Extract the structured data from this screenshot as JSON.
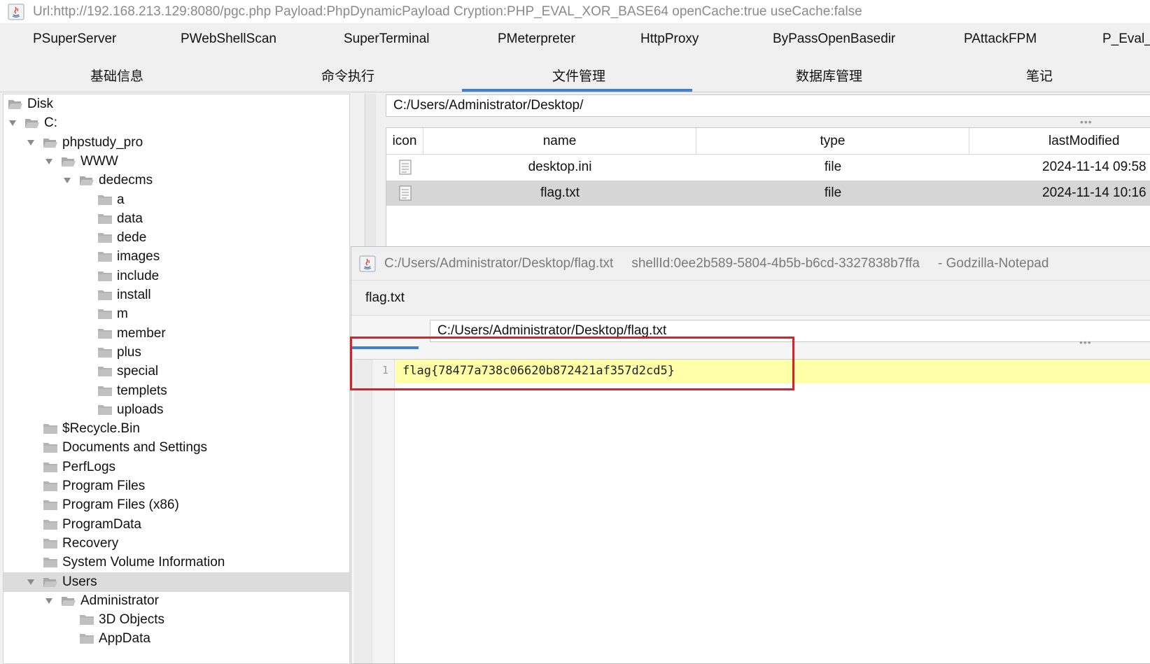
{
  "window": {
    "title": "Url:http://192.168.213.129:8080/pgc.php Payload:PhpDynamicPayload Cryption:PHP_EVAL_XOR_BASE64 openCache:true useCache:false"
  },
  "plugins": [
    "PSuperServer",
    "PWebShellScan",
    "SuperTerminal",
    "PMeterpreter",
    "HttpProxy",
    "ByPassOpenBasedir",
    "PAttackFPM",
    "P_Eval_C"
  ],
  "main_tabs": [
    "基础信息",
    "命令执行",
    "文件管理",
    "数据库管理",
    "笔记"
  ],
  "active_tab": "文件管理",
  "tree": {
    "items": [
      {
        "label": "Disk",
        "level": 0,
        "expanded": true
      },
      {
        "label": "C:",
        "level": 0,
        "expanded": true
      },
      {
        "label": "phpstudy_pro",
        "level": 1,
        "expanded": true
      },
      {
        "label": "WWW",
        "level": 2,
        "expanded": true
      },
      {
        "label": "dedecms",
        "level": 3,
        "expanded": true
      },
      {
        "label": "a",
        "level": 4
      },
      {
        "label": "data",
        "level": 4
      },
      {
        "label": "dede",
        "level": 4
      },
      {
        "label": "images",
        "level": 4
      },
      {
        "label": "include",
        "level": 4
      },
      {
        "label": "install",
        "level": 4
      },
      {
        "label": "m",
        "level": 4
      },
      {
        "label": "member",
        "level": 4
      },
      {
        "label": "plus",
        "level": 4
      },
      {
        "label": "special",
        "level": 4
      },
      {
        "label": "templets",
        "level": 4
      },
      {
        "label": "uploads",
        "level": 4
      },
      {
        "label": "$Recycle.Bin",
        "level": 1
      },
      {
        "label": "Documents and Settings",
        "level": 1
      },
      {
        "label": "PerfLogs",
        "level": 1
      },
      {
        "label": "Program Files",
        "level": 1
      },
      {
        "label": "Program Files (x86)",
        "level": 1
      },
      {
        "label": "ProgramData",
        "level": 1
      },
      {
        "label": "Recovery",
        "level": 1
      },
      {
        "label": "System Volume Information",
        "level": 1
      },
      {
        "label": "Users",
        "level": 1,
        "expanded": true,
        "selected": true
      },
      {
        "label": "Administrator",
        "level": 2,
        "expanded": true
      },
      {
        "label": "3D Objects",
        "level": 3
      },
      {
        "label": "AppData",
        "level": 3
      }
    ]
  },
  "file_manager": {
    "path": "C:/Users/Administrator/Desktop/",
    "columns": [
      "icon",
      "name",
      "type",
      "lastModified"
    ],
    "rows": [
      {
        "name": "desktop.ini",
        "type": "file",
        "lastModified": "2024-11-14 09:58"
      },
      {
        "name": "flag.txt",
        "type": "file",
        "lastModified": "2024-11-14 10:16",
        "selected": true
      }
    ]
  },
  "notepad": {
    "title_path": "C:/Users/Administrator/Desktop/flag.txt",
    "shell_id": "shellId:0ee2b589-5804-4b5b-b6cd-3327838b7ffa",
    "app_name": "- Godzilla-Notepad",
    "tab_label": "flag.txt",
    "path": "C:/Users/Administrator/Desktop/flag.txt",
    "line_number": "1",
    "content": "flag{78477a738c06620b872421af357d2cd5}"
  },
  "ellipsis": "•••",
  "colors": {
    "accent": "#3d7fd0",
    "highlight_box": "#d0262b",
    "current_line": "#ffffa8",
    "selected_row": "#d6d6d6"
  }
}
